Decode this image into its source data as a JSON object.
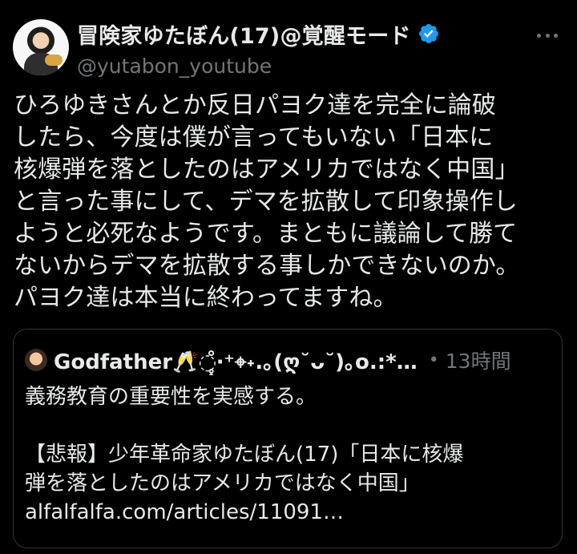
{
  "author": {
    "display_name": "冒険家ゆたぼん(17)@覚醒モード",
    "handle": "@yutabon_youtube",
    "verified": true,
    "verified_color": "#1d9bf0",
    "avatar_icon": "profile-photo"
  },
  "tweet": {
    "text": "ひろゆきさんとか反日パヨク達を完全に論破\nしたら、今度は僕が言ってもいない「日本に\n核爆弾を落としたのはアメリカではなく中国」\nと言った事にして、デマを拡散して印象操作し\nようと必死なようです。まともに議論して勝て\nないからデマを拡散する事しかできないのか。\nパヨク達は本当に終わってますね。"
  },
  "quote": {
    "display_name": "Godfather🥂◌̥̥̥̥̊‧⁺⌖˖.｡(ღ˘ᴗ˘)｡o.:*…",
    "separator": "•",
    "time": "13時間",
    "text": "義務教育の重要性を実感する。\n\n【悲報】少年革命家ゆたぼん(17)「日本に核爆\n弾を落としたのはアメリカではなく中国」\nalfalfalfa.com/articles/11091…"
  },
  "colors": {
    "background": "#000000",
    "text_primary": "#e7e9ea",
    "text_secondary": "#71767b",
    "border": "#2f3336"
  }
}
